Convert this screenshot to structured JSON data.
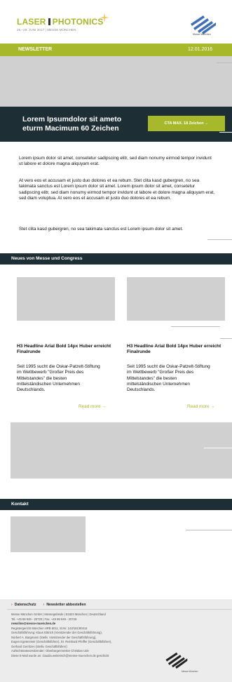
{
  "header": {
    "logo_left": "LASER",
    "logo_right": "PHOTONICS",
    "logo_sub": "26.–29. JUNI 2017 | MESSE MÜNCHEN",
    "logo_mm_text": "Messe München"
  },
  "newsletter_bar": {
    "label": "NEWSLETTER",
    "date": "12.01.2016"
  },
  "cta": {
    "headline_line1": "Lorem Ipsumdolor sit ameto",
    "headline_line2": "eturm Macimum 60 Zeichen",
    "button_label": "CTA MAX. 18 Zeichen →"
  },
  "body": {
    "p1": "Lorem ipsum dolor sit amet, consetetur sadipscing elitr, sed diam nonumy eirmod tempor invidunt ut labore et dolore magna aliquyam erat.",
    "p2": "At vero eos et accusam et justo duo dolores et ea rebum. Stet clita kasd gubergren, no sea takimata sanctus est Lorem ipsum dolor sit amet. Lorem ipsum dolor sit amet, consetetur sadipscing elitr, sed diam nonumy eirmod tempor invidunt ut labore et dolore magna aliquyam erat, sed diam voluptua. At vero eos et accusam et justo duo dolores et ea rebum.",
    "p3": "Stet clita kasd gubergren, no sea takimata sanctus est Lorem ipsum dolor sit amet."
  },
  "section_news": {
    "title": "Neues von Messe und Congress",
    "cards": [
      {
        "headline": "H3 Headline Arial Bold 14px Huber erreicht Finalrunde",
        "text": "Seit 1995 sucht die Oskar-Patzelt-Stiftung im Wettbewerb \"Großer Preis des Mittelstandes\" die besten mittelständischen Unternehmen Deutschlands.",
        "more": "Read more →"
      },
      {
        "headline": "H3 Headline Arial Bold 14px Huber erreicht Finalrunde",
        "text": "Seit 1995 sucht die Oskar-Patzelt-Stiftung im Wettbewerb \"Großer Preis des Mittelstandes\" die besten mittelständischen Unternehmen Deutschlands.",
        "more": "Read more →"
      }
    ]
  },
  "section_contact": {
    "title": "Kontakt"
  },
  "footer": {
    "link_privacy": "Datenschutz",
    "link_unsubscribe": "Newsletter abbestellen",
    "lines": [
      "Messe München GmbH | Messegelände | 81823 München | Deutschland",
      "Tel. +49 89 949 - 20720 | Fax. +49 89 949 - 20729",
      "newsline@messe-muenchen.de",
      "Registergericht München HRB 6011, St.Nr. 143/181/90414",
      "Geschäftsführung: Klaus Dittrich (Vorsitzender der Geschäftsführung),",
      "Norbert A. Bargmann (Stellv. Vorsitzender der Geschäftsführung),",
      "Eugen Egetenmeir (Geschäftsführer), Dr. Reinhard Pfeiffer (Geschäftsführer),",
      "Gerhard Gerritzen (Stellv. Geschäftsführer)",
      "Aufsichtsratsvorsitzender: Oberbürgermeister Christian Ude",
      "Diese E-Mail wurde an: claudia.weiterisch@messe-muenchen.de geschickt"
    ],
    "logo_text": "Messe München"
  },
  "colors": {
    "accent": "#a7b82a",
    "dark": "#1d2f35",
    "placeholder": "#d0d0d0",
    "link_arrow": "#c1272d"
  }
}
